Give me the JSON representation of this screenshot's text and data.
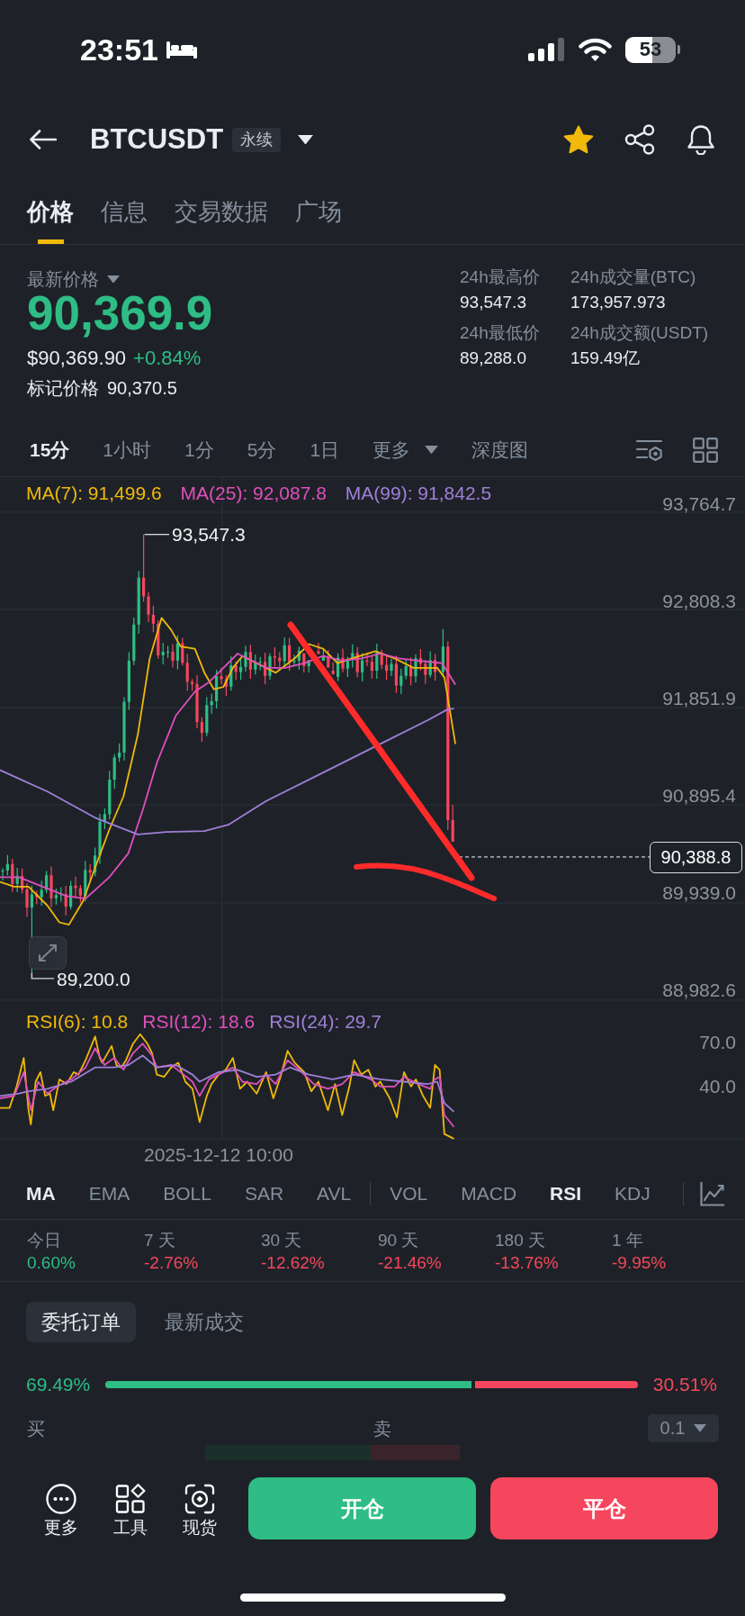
{
  "status_bar": {
    "time": "23:51",
    "battery": "53"
  },
  "header": {
    "title": "BTCUSDT",
    "tag": "永续",
    "favorite": true
  },
  "tabs": [
    {
      "label": "价格",
      "selected": true
    },
    {
      "label": "信息",
      "selected": false
    },
    {
      "label": "交易数据",
      "selected": false
    },
    {
      "label": "广场",
      "selected": false
    }
  ],
  "ticker": {
    "price_label": "最新价格",
    "price": "90,369.9",
    "rising": true,
    "usd_price": "$90,369.90",
    "change": "+0.84%",
    "mark_label": "标记价格",
    "mark_price": "90,370.5",
    "stats": [
      {
        "label": "24h最高价",
        "value": "93,547.3"
      },
      {
        "label": "24h成交量(BTC)",
        "value": "173,957.973"
      },
      {
        "label": "24h最低价",
        "value": "89,288.0"
      },
      {
        "label": "24h成交额(USDT)",
        "value": "159.49亿"
      }
    ]
  },
  "intervals": [
    {
      "label": "15分",
      "kind": "interval",
      "selected": true
    },
    {
      "label": "1小时",
      "kind": "interval",
      "selected": false
    },
    {
      "label": "1分",
      "kind": "interval",
      "selected": false
    },
    {
      "label": "5分",
      "kind": "interval",
      "selected": false
    },
    {
      "label": "1日",
      "kind": "interval",
      "selected": false
    },
    {
      "label": "更多",
      "kind": "dropdown",
      "selected": false
    },
    {
      "label": "深度图",
      "kind": "interval",
      "selected": false
    }
  ],
  "chart": {
    "ma_legend": [
      {
        "label": "MA(7): 91,499.6",
        "color": "#f0b90b"
      },
      {
        "label": "MA(25): 92,087.8",
        "color": "#e04fbd"
      },
      {
        "label": "MA(99): 91,842.5",
        "color": "#a07fd8"
      }
    ],
    "price_axis": [
      "93,764.7",
      "92,808.3",
      "91,851.9",
      "90,895.4",
      "89,939.0",
      "88,982.6"
    ],
    "high_label": "93,547.3",
    "low_label": "89,200.0",
    "last_price_tag": "90,388.8",
    "rsi_legend": [
      {
        "label": "RSI(6): 10.8",
        "color": "#f0b90b"
      },
      {
        "label": "RSI(12): 18.6",
        "color": "#e04fbd"
      },
      {
        "label": "RSI(24): 29.7",
        "color": "#a07fd8"
      }
    ],
    "rsi_axis": [
      "70.0",
      "40.0"
    ],
    "time_label": "2025-12-12 10:00"
  },
  "indicators": {
    "main": [
      {
        "label": "MA",
        "selected": true
      },
      {
        "label": "EMA",
        "selected": false
      },
      {
        "label": "BOLL",
        "selected": false
      },
      {
        "label": "SAR",
        "selected": false
      },
      {
        "label": "AVL",
        "selected": false
      }
    ],
    "sub": [
      {
        "label": "VOL",
        "selected": false
      },
      {
        "label": "MACD",
        "selected": false
      },
      {
        "label": "RSI",
        "selected": true
      },
      {
        "label": "KDJ",
        "selected": false
      }
    ]
  },
  "performance": [
    {
      "label": "今日",
      "value": "0.60%",
      "color": "#2ebd85"
    },
    {
      "label": "7 天",
      "value": "-2.76%",
      "color": "#f6465d"
    },
    {
      "label": "30 天",
      "value": "-12.62%",
      "color": "#f6465d"
    },
    {
      "label": "90 天",
      "value": "-21.46%",
      "color": "#f6465d"
    },
    {
      "label": "180 天",
      "value": "-13.76%",
      "color": "#f6465d"
    },
    {
      "label": "1 年",
      "value": "-9.95%",
      "color": "#f6465d"
    }
  ],
  "order_tabs": [
    {
      "label": "委托订单",
      "selected": true
    },
    {
      "label": "最新成交",
      "selected": false
    }
  ],
  "order_ratio": {
    "buy": "69.49%",
    "sell": "30.51%",
    "level": 0.6949
  },
  "order_book": {
    "buy_label": "买",
    "sell_label": "卖",
    "precision": "0.1"
  },
  "bottom_bar": {
    "tools": [
      {
        "label": "更多",
        "kind": "more"
      },
      {
        "label": "工具",
        "kind": "tools"
      },
      {
        "label": "现货",
        "kind": "spot"
      }
    ],
    "actions": [
      {
        "label": "开仓",
        "kind": "open"
      },
      {
        "label": "平仓",
        "kind": "close"
      }
    ]
  }
}
